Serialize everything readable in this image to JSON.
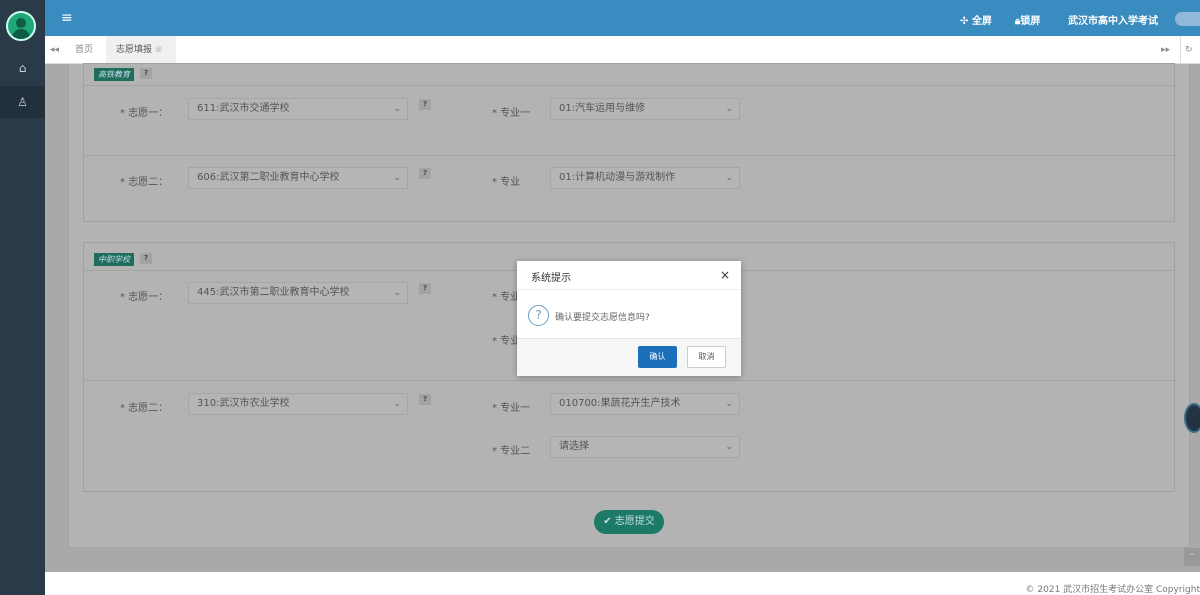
{
  "header": {
    "fullscreen": "全屏",
    "lock": "锁屏",
    "org": "武汉市高中入学考试"
  },
  "tabs": [
    {
      "label": "首页"
    },
    {
      "label": "志愿填报"
    }
  ],
  "sections": [
    {
      "badge": "高铁教育",
      "rows": [
        {
          "label": "* 志愿一：",
          "school": "611:武汉市交通学校",
          "majors": [
            {
              "label": "* 专业一",
              "value": "01:汽车运用与维修"
            }
          ]
        },
        {
          "label": "* 志愿二：",
          "school": "606:武汉第二职业教育中心学校",
          "majors": [
            {
              "label": "* 专业",
              "value": "01:计算机动漫与游戏制作"
            }
          ]
        }
      ]
    },
    {
      "badge": "中职学校",
      "rows": [
        {
          "label": "* 志愿一：",
          "school": "445:武汉市第二职业教育中心学校",
          "majors": [
            {
              "label": "* 专业一",
              "value": ""
            },
            {
              "label": "* 专业二",
              "value": ""
            }
          ]
        },
        {
          "label": "* 志愿二：",
          "school": "310:武汉市农业学校",
          "majors": [
            {
              "label": "* 专业一",
              "value": "010700:果蔬花卉生产技术"
            },
            {
              "label": "* 专业二",
              "value": "请选择"
            }
          ]
        }
      ]
    }
  ],
  "help": "?",
  "submit": "志愿提交",
  "modal": {
    "title": "系统提示",
    "message": "确认要提交志愿信息吗?",
    "ok": "确认",
    "cancel": "取消",
    "close": "×"
  },
  "footer": {
    "copyright": "© 2021 武汉市招生考试办公室 Copyright"
  },
  "colors": {
    "header": "#3a8cc0",
    "sidebar": "#2a3a48",
    "accent": "#1c7a66",
    "primary": "#1c6fba"
  }
}
